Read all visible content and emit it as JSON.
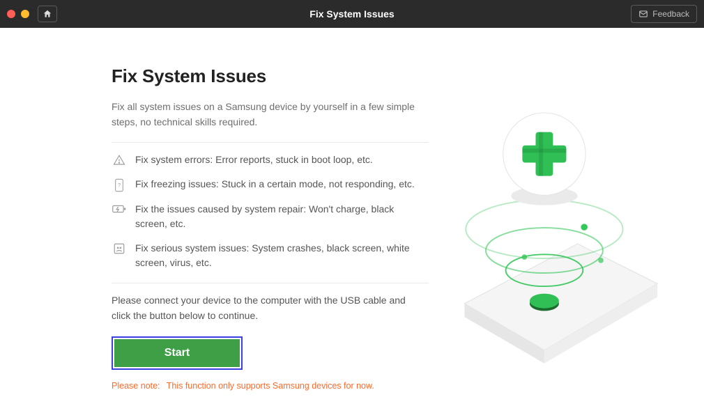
{
  "titlebar": {
    "window_title": "Fix System Issues",
    "feedback_label": "Feedback"
  },
  "main": {
    "heading": "Fix System Issues",
    "subtitle": "Fix all system issues on a Samsung device by yourself in a few simple steps, no technical skills required.",
    "features": [
      {
        "icon": "warning-triangle-icon",
        "text": "Fix system errors: Error reports, stuck in boot loop, etc."
      },
      {
        "icon": "freeze-icon",
        "text": "Fix freezing issues: Stuck in a certain mode, not responding, etc."
      },
      {
        "icon": "charge-icon",
        "text": "Fix the issues caused by system repair: Won't charge, black screen, etc."
      },
      {
        "icon": "crash-icon",
        "text": "Fix serious system issues: System crashes, black screen, white screen, virus, etc."
      }
    ],
    "connect_text": "Please connect your device to the computer with the USB cable and click the button below to continue.",
    "start_label": "Start",
    "note_prefix": "Please note:",
    "note_text": "This function only supports Samsung devices for now."
  },
  "colors": {
    "accent_green": "#3f9f47",
    "highlight_blue": "#3a3fe0",
    "warning_orange": "#ff6a2b"
  }
}
